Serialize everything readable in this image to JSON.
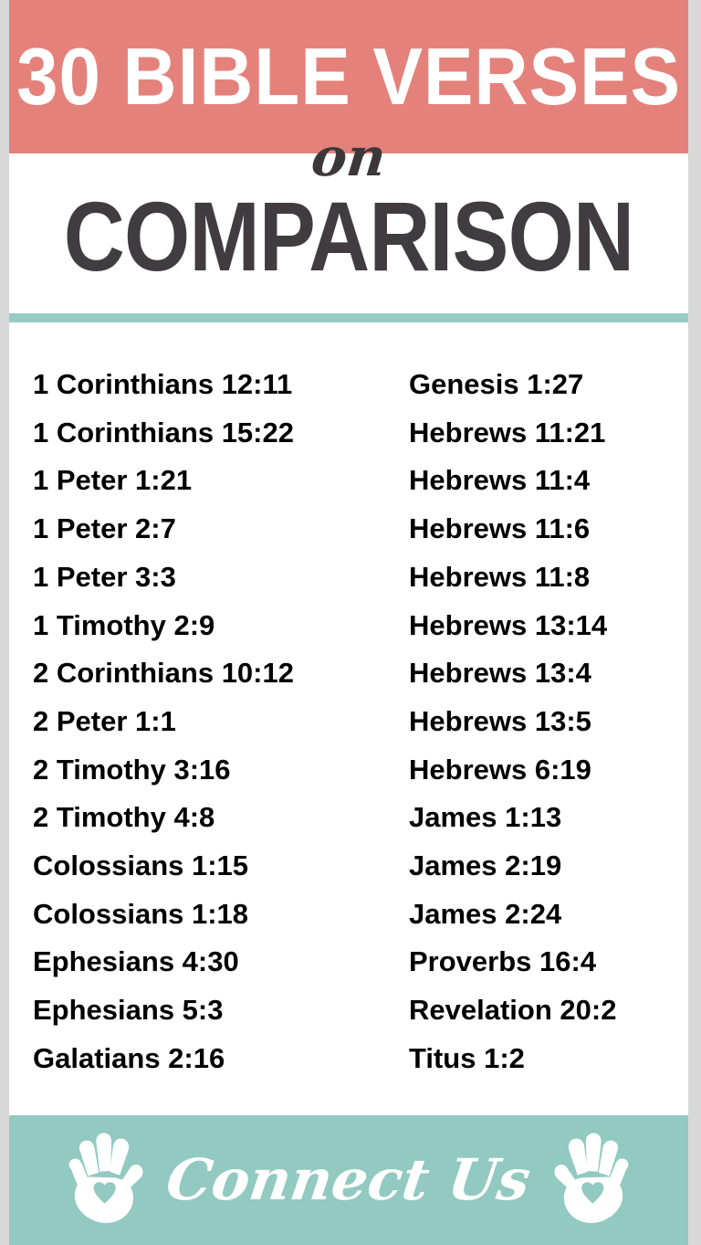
{
  "poster": {
    "title_main": "30 BIBLE VERSES",
    "title_script": "on",
    "title_sub": "COMPARISON",
    "colors": {
      "coral": "#E4817B",
      "teal": "#97CCC2",
      "footer_teal": "#92C9C0",
      "dark": "#413C3F",
      "verse_text": "#000000",
      "page_edge_gray": "#D8D8D8"
    }
  },
  "verses": {
    "left_column": [
      "1 Corinthians 12:11",
      "1 Corinthians 15:22",
      "1 Peter 1:21",
      "1 Peter 2:7",
      "1 Peter 3:3",
      "1 Timothy 2:9",
      "2 Corinthians 10:12",
      "2 Peter 1:1",
      "2 Timothy 3:16",
      "2 Timothy 4:8",
      "Colossians 1:15",
      "Colossians 1:18",
      "Ephesians 4:30",
      "Ephesians 5:3",
      "Galatians 2:16"
    ],
    "right_column": [
      "Genesis 1:27",
      "Hebrews 11:21",
      "Hebrews 11:4",
      "Hebrews 11:6",
      "Hebrews 11:8",
      "Hebrews 13:14",
      "Hebrews 13:4",
      "Hebrews 13:5",
      "Hebrews 6:19",
      "James 1:13",
      "James 2:19",
      "James 2:24",
      "Proverbs 16:4",
      "Revelation 20:2",
      "Titus 1:2"
    ]
  },
  "footer": {
    "brand": "Connect Us",
    "left_icon": "hand-heart-icon",
    "right_icon": "hand-heart-icon"
  }
}
